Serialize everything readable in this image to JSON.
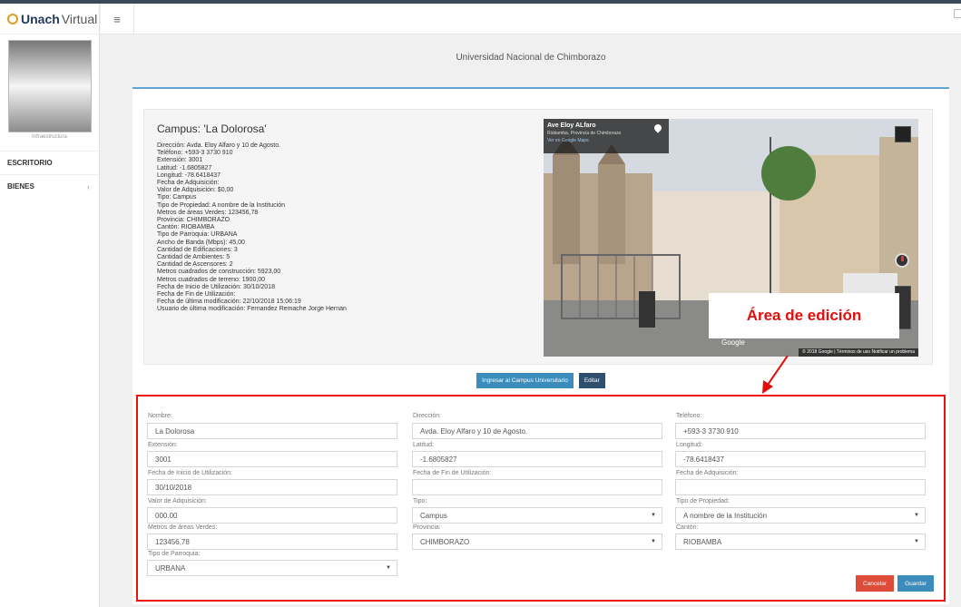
{
  "brand": {
    "name_bold": "Unach",
    "name_light": "Virtual"
  },
  "sidebar": {
    "user_caption": "Infraestructura",
    "items": [
      {
        "label": "ESCRITORIO"
      },
      {
        "label": "BIENES",
        "chevron": "‹"
      }
    ]
  },
  "header": {
    "menu_icon": "≡",
    "page_title": "Universidad Nacional de Chimborazo"
  },
  "campus": {
    "title": "Campus: 'La Dolorosa'",
    "details": [
      "Dirección: Avda. Eloy Alfaro y 10 de Agosto.",
      "Teléfono: +593-3 3730 910",
      "Extensión: 3001",
      "Latitud: -1.6805827",
      "Longitud: -78.6418437",
      "Fecha de Adquisición:",
      "Valor de Adquisición: $0,00",
      "Tipo: Campus",
      "Tipo de Propiedad: A nombre de la Institución",
      "Metros de áreas Verdes: 123456,78",
      "Provincia: CHIMBORAZO",
      "Cantón: RIOBAMBA",
      "Tipo de Parroquia: URBANA",
      "Ancho de Banda (Mbps): 45,00",
      "Cantidad de Edificaciones: 3",
      "Cantidad de Ambientes: 5",
      "Cantidad de Ascensores: 2",
      "Metros cuadrados de construcción: 5923,00",
      "Metros cuadrados de terreno: 1900,00",
      "Fecha de Inicio de Utilización: 30/10/2018",
      "Fecha de Fin de Utilización:",
      "Fecha de última modificación: 22/10/2018 15:06:19",
      "Usuario de última modificación: Fernandez Remache Jorge Hernan"
    ]
  },
  "streetview": {
    "place": "Ave Eloy ALfaro",
    "region": "Riobamba, Provincia de Chimborazo",
    "maps_link": "Ver en Google Maps",
    "google": "Google",
    "footer": "© 2018 Google | Términos de uso   Notificar un problema"
  },
  "annotation": {
    "text": "Área de edición",
    "color": "#e20e0e"
  },
  "buttons": {
    "ingresar": "Ingresar al Campus Universitario",
    "editar": "Editar",
    "cancelar": "Cancelar",
    "guardar": "Guardar"
  },
  "form": {
    "nombre": {
      "label": "Nombre:",
      "value": "La Dolorosa"
    },
    "direccion": {
      "label": "Dirección:",
      "value": "Avda. Eloy Alfaro y 10 de Agosto."
    },
    "telefono": {
      "label": "Teléfono:",
      "value": "+593-3 3730 910"
    },
    "extension": {
      "label": "Extensión:",
      "value": "3001"
    },
    "latitud": {
      "label": "Latitud:",
      "value": "-1.6805827"
    },
    "longitud": {
      "label": "Longitud:",
      "value": "-78.6418437"
    },
    "fecha_inicio": {
      "label": "Fecha de Inicio de Utilización:",
      "value": "30/10/2018"
    },
    "fecha_fin": {
      "label": "Fecha de Fin de Utilización:",
      "value": ""
    },
    "fecha_adquisicion": {
      "label": "Fecha de Adquisición:",
      "value": ""
    },
    "valor_adquisicion": {
      "label": "Valor de Adquisición:",
      "value": "000.00"
    },
    "tipo": {
      "label": "Tipo:",
      "value": "Campus"
    },
    "tipo_propiedad": {
      "label": "Tipo de Propiedad:",
      "value": "A nombre de la Institución"
    },
    "metros_verdes": {
      "label": "Metros de áreas Verdes:",
      "value": "123456,78"
    },
    "provincia": {
      "label": "Provincia:",
      "value": "CHIMBORAZO"
    },
    "canton": {
      "label": "Cantón:",
      "value": "RIOBAMBA"
    },
    "tipo_parroquia": {
      "label": "Tipo de Parroquia:",
      "value": "URBANA"
    }
  }
}
